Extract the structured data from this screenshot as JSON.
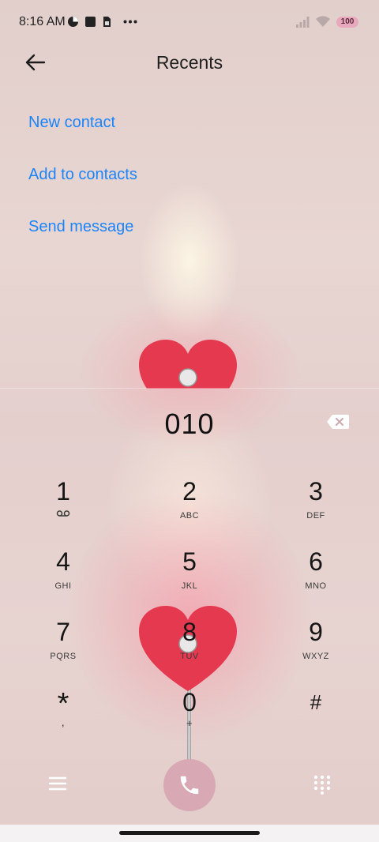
{
  "status_bar": {
    "time": "8:16 AM",
    "battery": "100",
    "icons": [
      "data-saver-icon",
      "stop-square-icon",
      "sim-card-icon",
      "more-dots-icon",
      "signal-icon",
      "wifi-icon"
    ]
  },
  "header": {
    "title": "Recents"
  },
  "actions": [
    {
      "label": "New contact"
    },
    {
      "label": "Add to contacts"
    },
    {
      "label": "Send message"
    }
  ],
  "dialer": {
    "number": "010"
  },
  "keypad": [
    {
      "digit": "1",
      "letters": ""
    },
    {
      "digit": "2",
      "letters": "ABC"
    },
    {
      "digit": "3",
      "letters": "DEF"
    },
    {
      "digit": "4",
      "letters": "GHI"
    },
    {
      "digit": "5",
      "letters": "JKL"
    },
    {
      "digit": "6",
      "letters": "MNO"
    },
    {
      "digit": "7",
      "letters": "PQRS"
    },
    {
      "digit": "8",
      "letters": "TUV"
    },
    {
      "digit": "9",
      "letters": "WXYZ"
    },
    {
      "digit": "*",
      "letters": ","
    },
    {
      "digit": "0",
      "letters": "+"
    },
    {
      "digit": "#",
      "letters": ""
    }
  ],
  "colors": {
    "accent": "#1a84ff",
    "call_button": "#d8a9b4",
    "battery_badge": "#e9a9bd"
  }
}
